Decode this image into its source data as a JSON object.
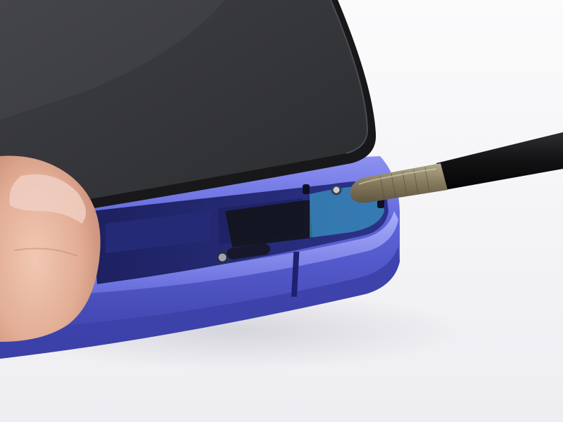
{
  "scene": {
    "subject": "phone-display-lifted-with-spudger",
    "colors": {
      "background": "#f7f7f9",
      "frame": "#5c63d8",
      "frame_dark": "#3a3fa4",
      "frame_highlight": "#a9aefc",
      "display_glass": "#35363a",
      "display_edge": "#1a1a1d",
      "internals": "#2a2f7a",
      "adhesive": "#3fb6d8",
      "spudger_handle": "#141416",
      "spudger_tip": "#8a7f62",
      "skin": "#e6b7a0",
      "skin_shadow": "#c98f78",
      "nail": "#f0cfc3"
    },
    "icons": {
      "tool": "spudger-icon",
      "component": "display-panel-icon"
    }
  }
}
